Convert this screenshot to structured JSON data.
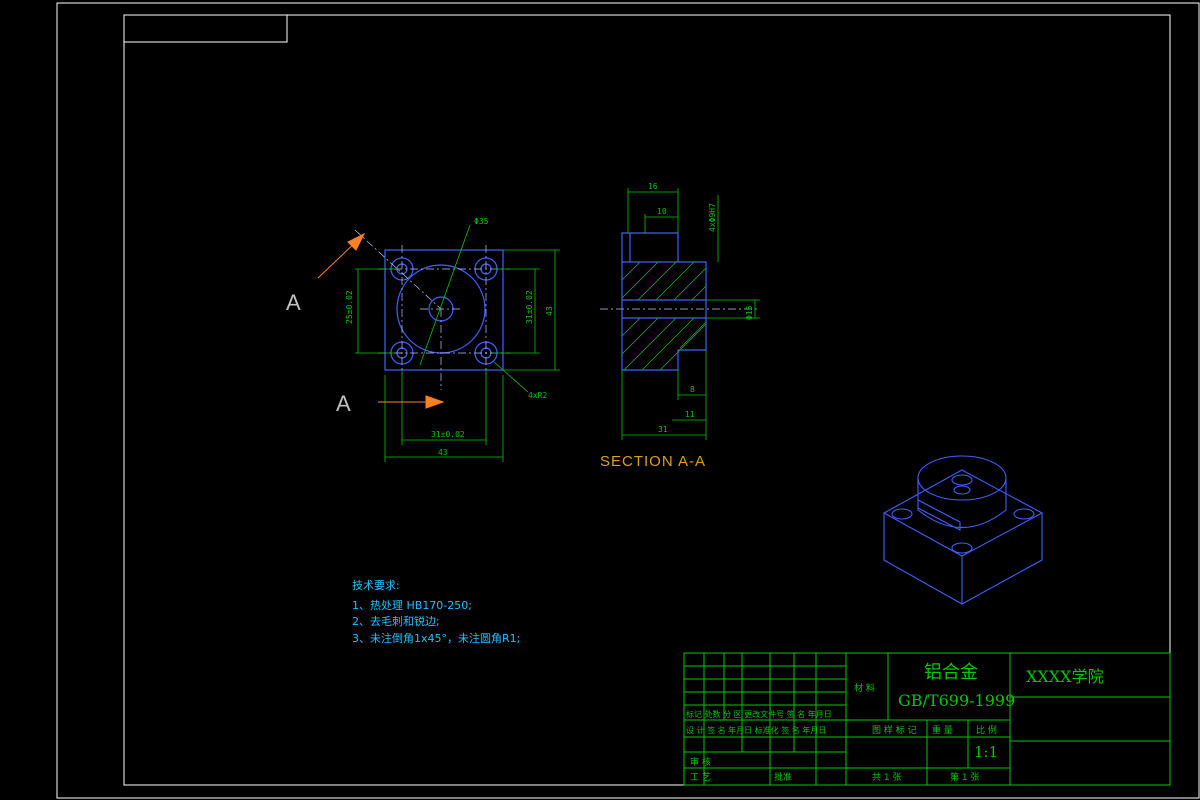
{
  "views": {
    "section_label": "A",
    "section_title": "SECTION A-A"
  },
  "dimensions": {
    "front_31": "31±0.02",
    "front_43_bottom": "43",
    "front_25": "25±0.02",
    "front_31_right": "31±0.02",
    "front_43_right": "43",
    "diameter_top": "Φ35",
    "radius_note": "4xR2",
    "sec_16": "16",
    "sec_10": "10",
    "sec_hole": "4xΦ9H7",
    "sec_phi5": "Φ15",
    "sec_8": "8",
    "sec_11": "11",
    "sec_31": "31"
  },
  "notes": {
    "title": "技术要求:",
    "line1": "1、热处理 HB170-250;",
    "line2": "2、去毛刺和锐边;",
    "line3": "3、未注倒角1x45°，未注圆角R1;"
  },
  "title_block": {
    "material_label": "材 料",
    "material_name": "铝合金",
    "standard": "GB/T699-1999",
    "school": "XXXX学院",
    "row_mark": "标记 处数  分 区 更改文件号 签 名  年月日",
    "row_design": "设 计 签 名 年月日 标准化 签 名 年月日",
    "row_review": "审 核",
    "row_process": "工 艺",
    "approve": "批准",
    "drawing_mark": "图 样 标 记",
    "weight": "重 量",
    "scale_label": "比 例",
    "scale": "1:1",
    "total_sheets": "共  1  张",
    "sheet_no": "第  1  张"
  }
}
